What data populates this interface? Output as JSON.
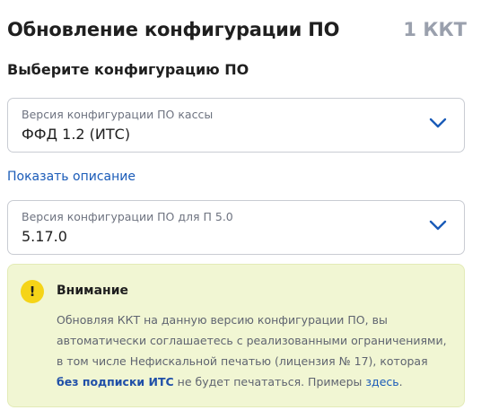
{
  "header": {
    "title": "Обновление конфигурации ПО",
    "kkt_count": "1 ККТ"
  },
  "section_title": "Выберите конфигурацию ПО",
  "selects": [
    {
      "label": "Версия конфигурации ПО кассы",
      "value": "ФФД 1.2 (ИТС)",
      "icon": "chevron-down-icon"
    },
    {
      "label": "Версия конфигурации ПО для П 5.0",
      "value": "5.17.0",
      "icon": "chevron-down-icon"
    }
  ],
  "show_description": "Показать описание",
  "warning": {
    "icon": "exclamation-icon",
    "icon_glyph": "!",
    "title": "Внимание",
    "text_part1": "Обновляя ККТ на данную версию конфигурации ПО, вы автоматически соглашаетесь с реализованными ограничениями, в том числе Нефискальной печатью (лицензия № 17), которая ",
    "text_bold": "без подписки ИТС",
    "text_part2": " не будет печататься. Примеры ",
    "link": "здесь",
    "text_end": "."
  },
  "colors": {
    "accent": "#1a5bb8",
    "warning_bg": "#f1f6d3",
    "warning_icon": "#f5d418"
  }
}
